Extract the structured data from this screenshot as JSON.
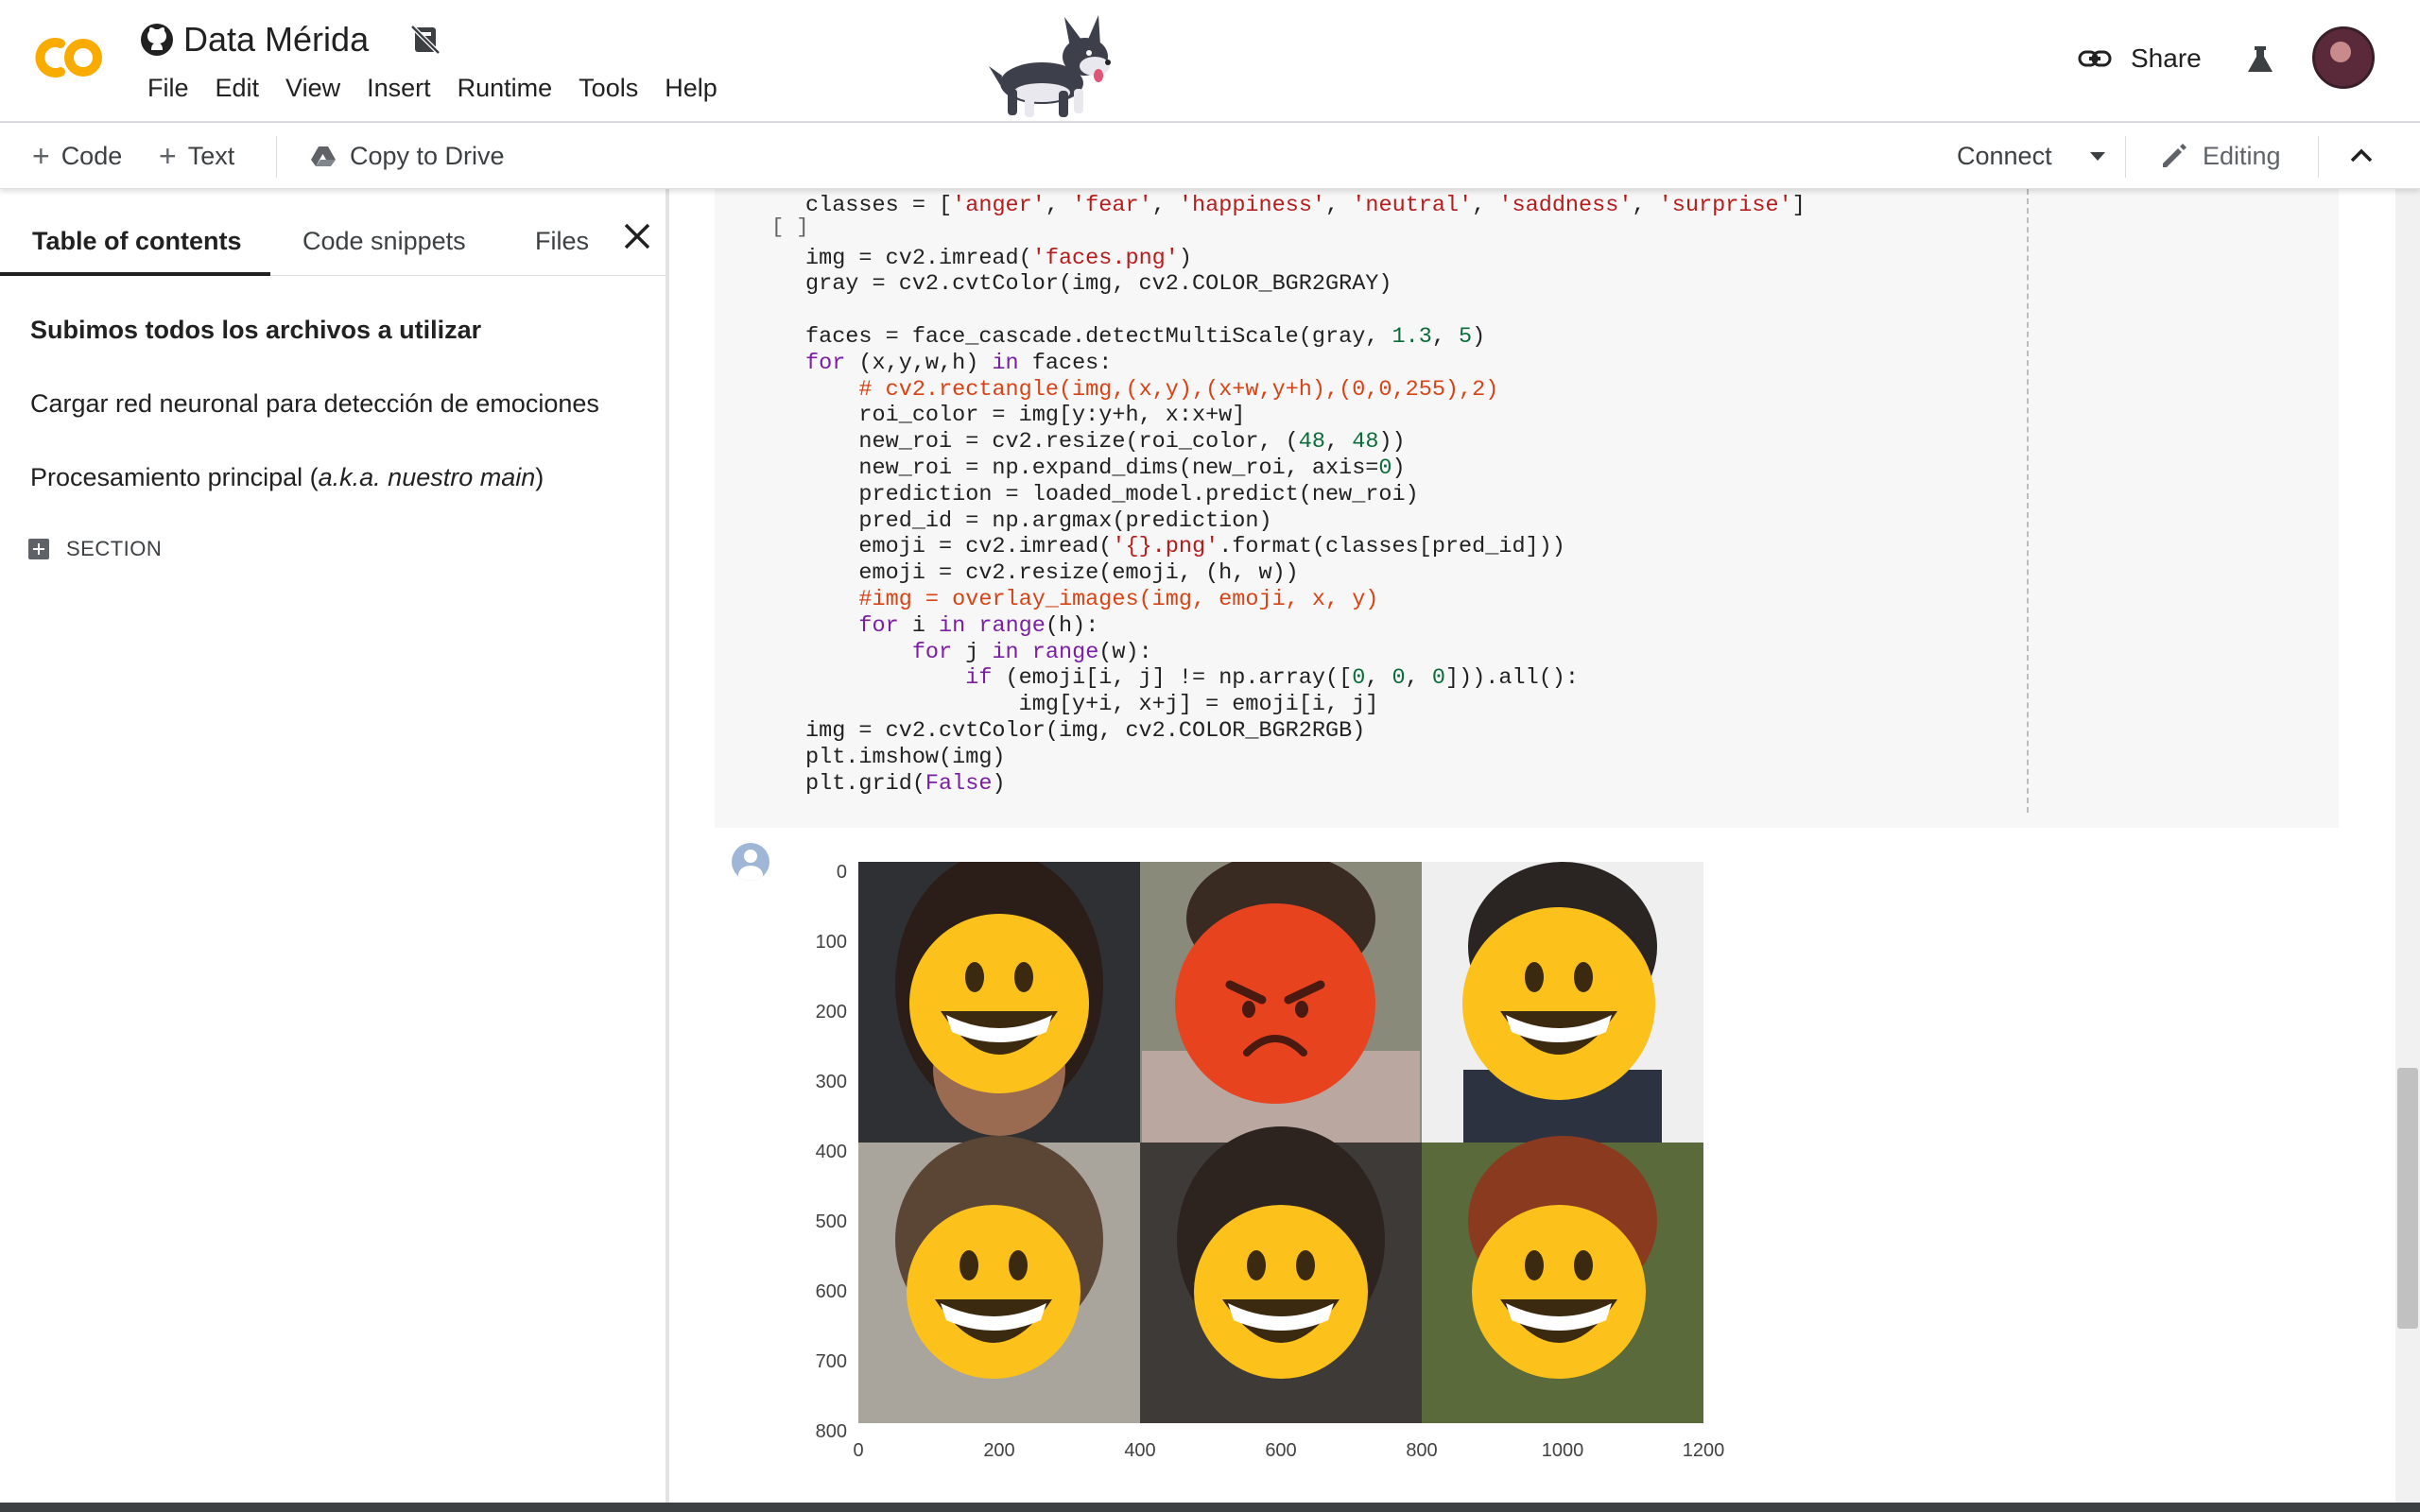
{
  "app": {
    "notebook_title": "Data Mérida",
    "menu": [
      "File",
      "Edit",
      "View",
      "Insert",
      "Runtime",
      "Tools",
      "Help"
    ],
    "share_label": "Share"
  },
  "toolbar": {
    "code_label": "Code",
    "text_label": "Text",
    "copy_to_drive_label": "Copy to Drive",
    "connect_label": "Connect",
    "editing_label": "Editing"
  },
  "sidebar": {
    "tabs": [
      "Table of contents",
      "Code snippets",
      "Files"
    ],
    "toc": [
      "Subimos todos los archivos a utilizar",
      "Cargar red neuronal para detección de emociones",
      "Procesamiento principal (",
      "a.k.a. nuestro main",
      ")"
    ],
    "section_label": "SECTION"
  },
  "cell": {
    "run_bracket": "[ ]",
    "code_lines": [
      "classes = ['anger', 'fear', 'happiness', 'neutral', 'saddness', 'surprise']",
      "",
      "img = cv2.imread('faces.png')",
      "gray = cv2.cvtColor(img, cv2.COLOR_BGR2GRAY)",
      "",
      "faces = face_cascade.detectMultiScale(gray, 1.3, 5)",
      "for (x,y,w,h) in faces:",
      "    # cv2.rectangle(img,(x,y),(x+w,y+h),(0,0,255),2)",
      "    roi_color = img[y:y+h, x:x+w]",
      "    new_roi = cv2.resize(roi_color, (48, 48))",
      "    new_roi = np.expand_dims(new_roi, axis=0)",
      "    prediction = loaded_model.predict(new_roi)",
      "    pred_id = np.argmax(prediction)",
      "    emoji = cv2.imread('{}.png'.format(classes[pred_id]))",
      "    emoji = cv2.resize(emoji, (h, w))",
      "    #img = overlay_images(img, emoji, x, y)",
      "    for i in range(h):",
      "        for j in range(w):",
      "            if (emoji[i, j] != np.array([0, 0, 0])).all():",
      "                img[y+i, x+j] = emoji[i, j]",
      "img = cv2.cvtColor(img, cv2.COLOR_BGR2RGB)",
      "plt.imshow(img)",
      "plt.grid(False)"
    ]
  },
  "output": {
    "y_ticks": [
      "0",
      "100",
      "200",
      "300",
      "400",
      "500",
      "600",
      "700",
      "800"
    ],
    "x_ticks": [
      "0",
      "200",
      "400",
      "600",
      "800",
      "1000",
      "1200"
    ],
    "faces": [
      {
        "emoji": "happiness"
      },
      {
        "emoji": "anger"
      },
      {
        "emoji": "happiness"
      },
      {
        "emoji": "happiness"
      },
      {
        "emoji": "happiness"
      },
      {
        "emoji": "happiness"
      }
    ]
  },
  "colors": {
    "logo_orange": "#F9AB00",
    "keyword": "#7b1fa2",
    "string": "#b71c1c",
    "number": "#0b6b3a",
    "comment": "#d84315"
  }
}
